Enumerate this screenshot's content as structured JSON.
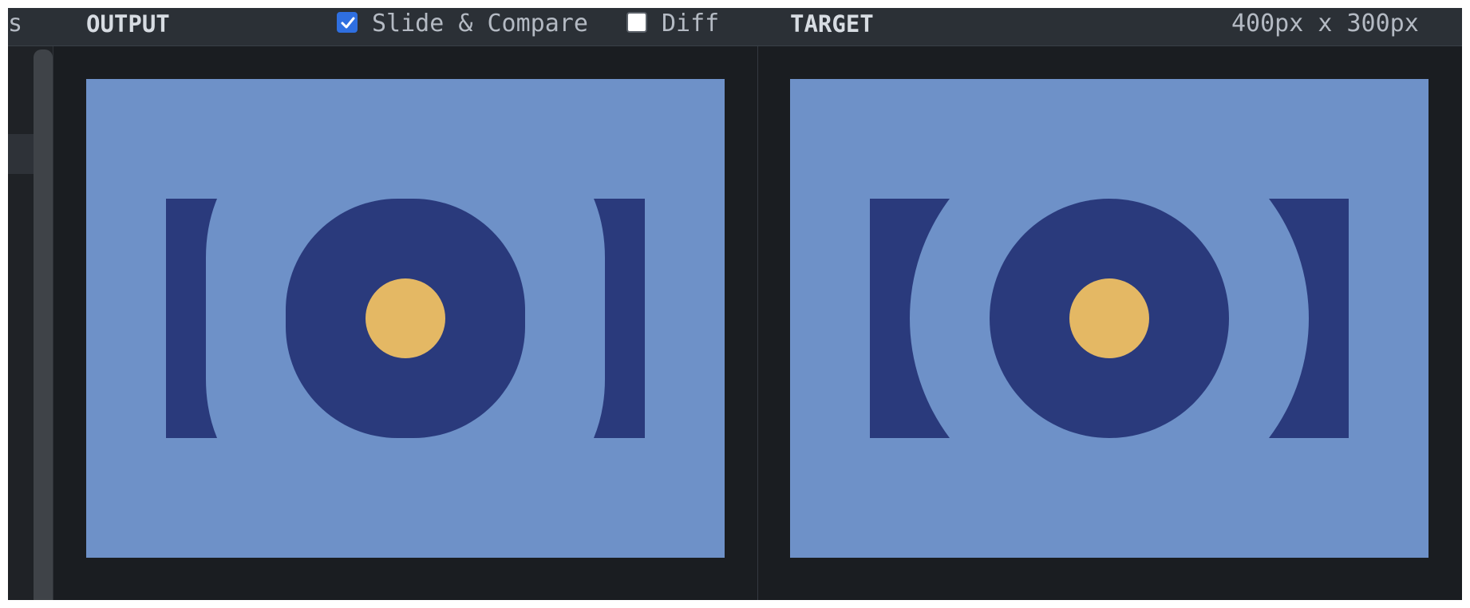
{
  "header": {
    "truncated_left": "s",
    "output_title": "OUTPUT",
    "slide_compare": {
      "label": "Slide & Compare",
      "checked": true
    },
    "diff": {
      "label": "Diff",
      "checked": false
    },
    "target_title": "TARGET",
    "dimensions": "400px x 300px"
  },
  "colors": {
    "background": "#6e91c8",
    "dark_shape": "#2a3a7c",
    "center_dot": "#e4b864",
    "app_bg": "#1a1d21",
    "header_bg": "#2b3036",
    "accent": "#2f6fe0"
  },
  "icons": {
    "slide_compare_checkbox": "checkbox-checked-icon",
    "diff_checkbox": "checkbox-unchecked-icon"
  }
}
